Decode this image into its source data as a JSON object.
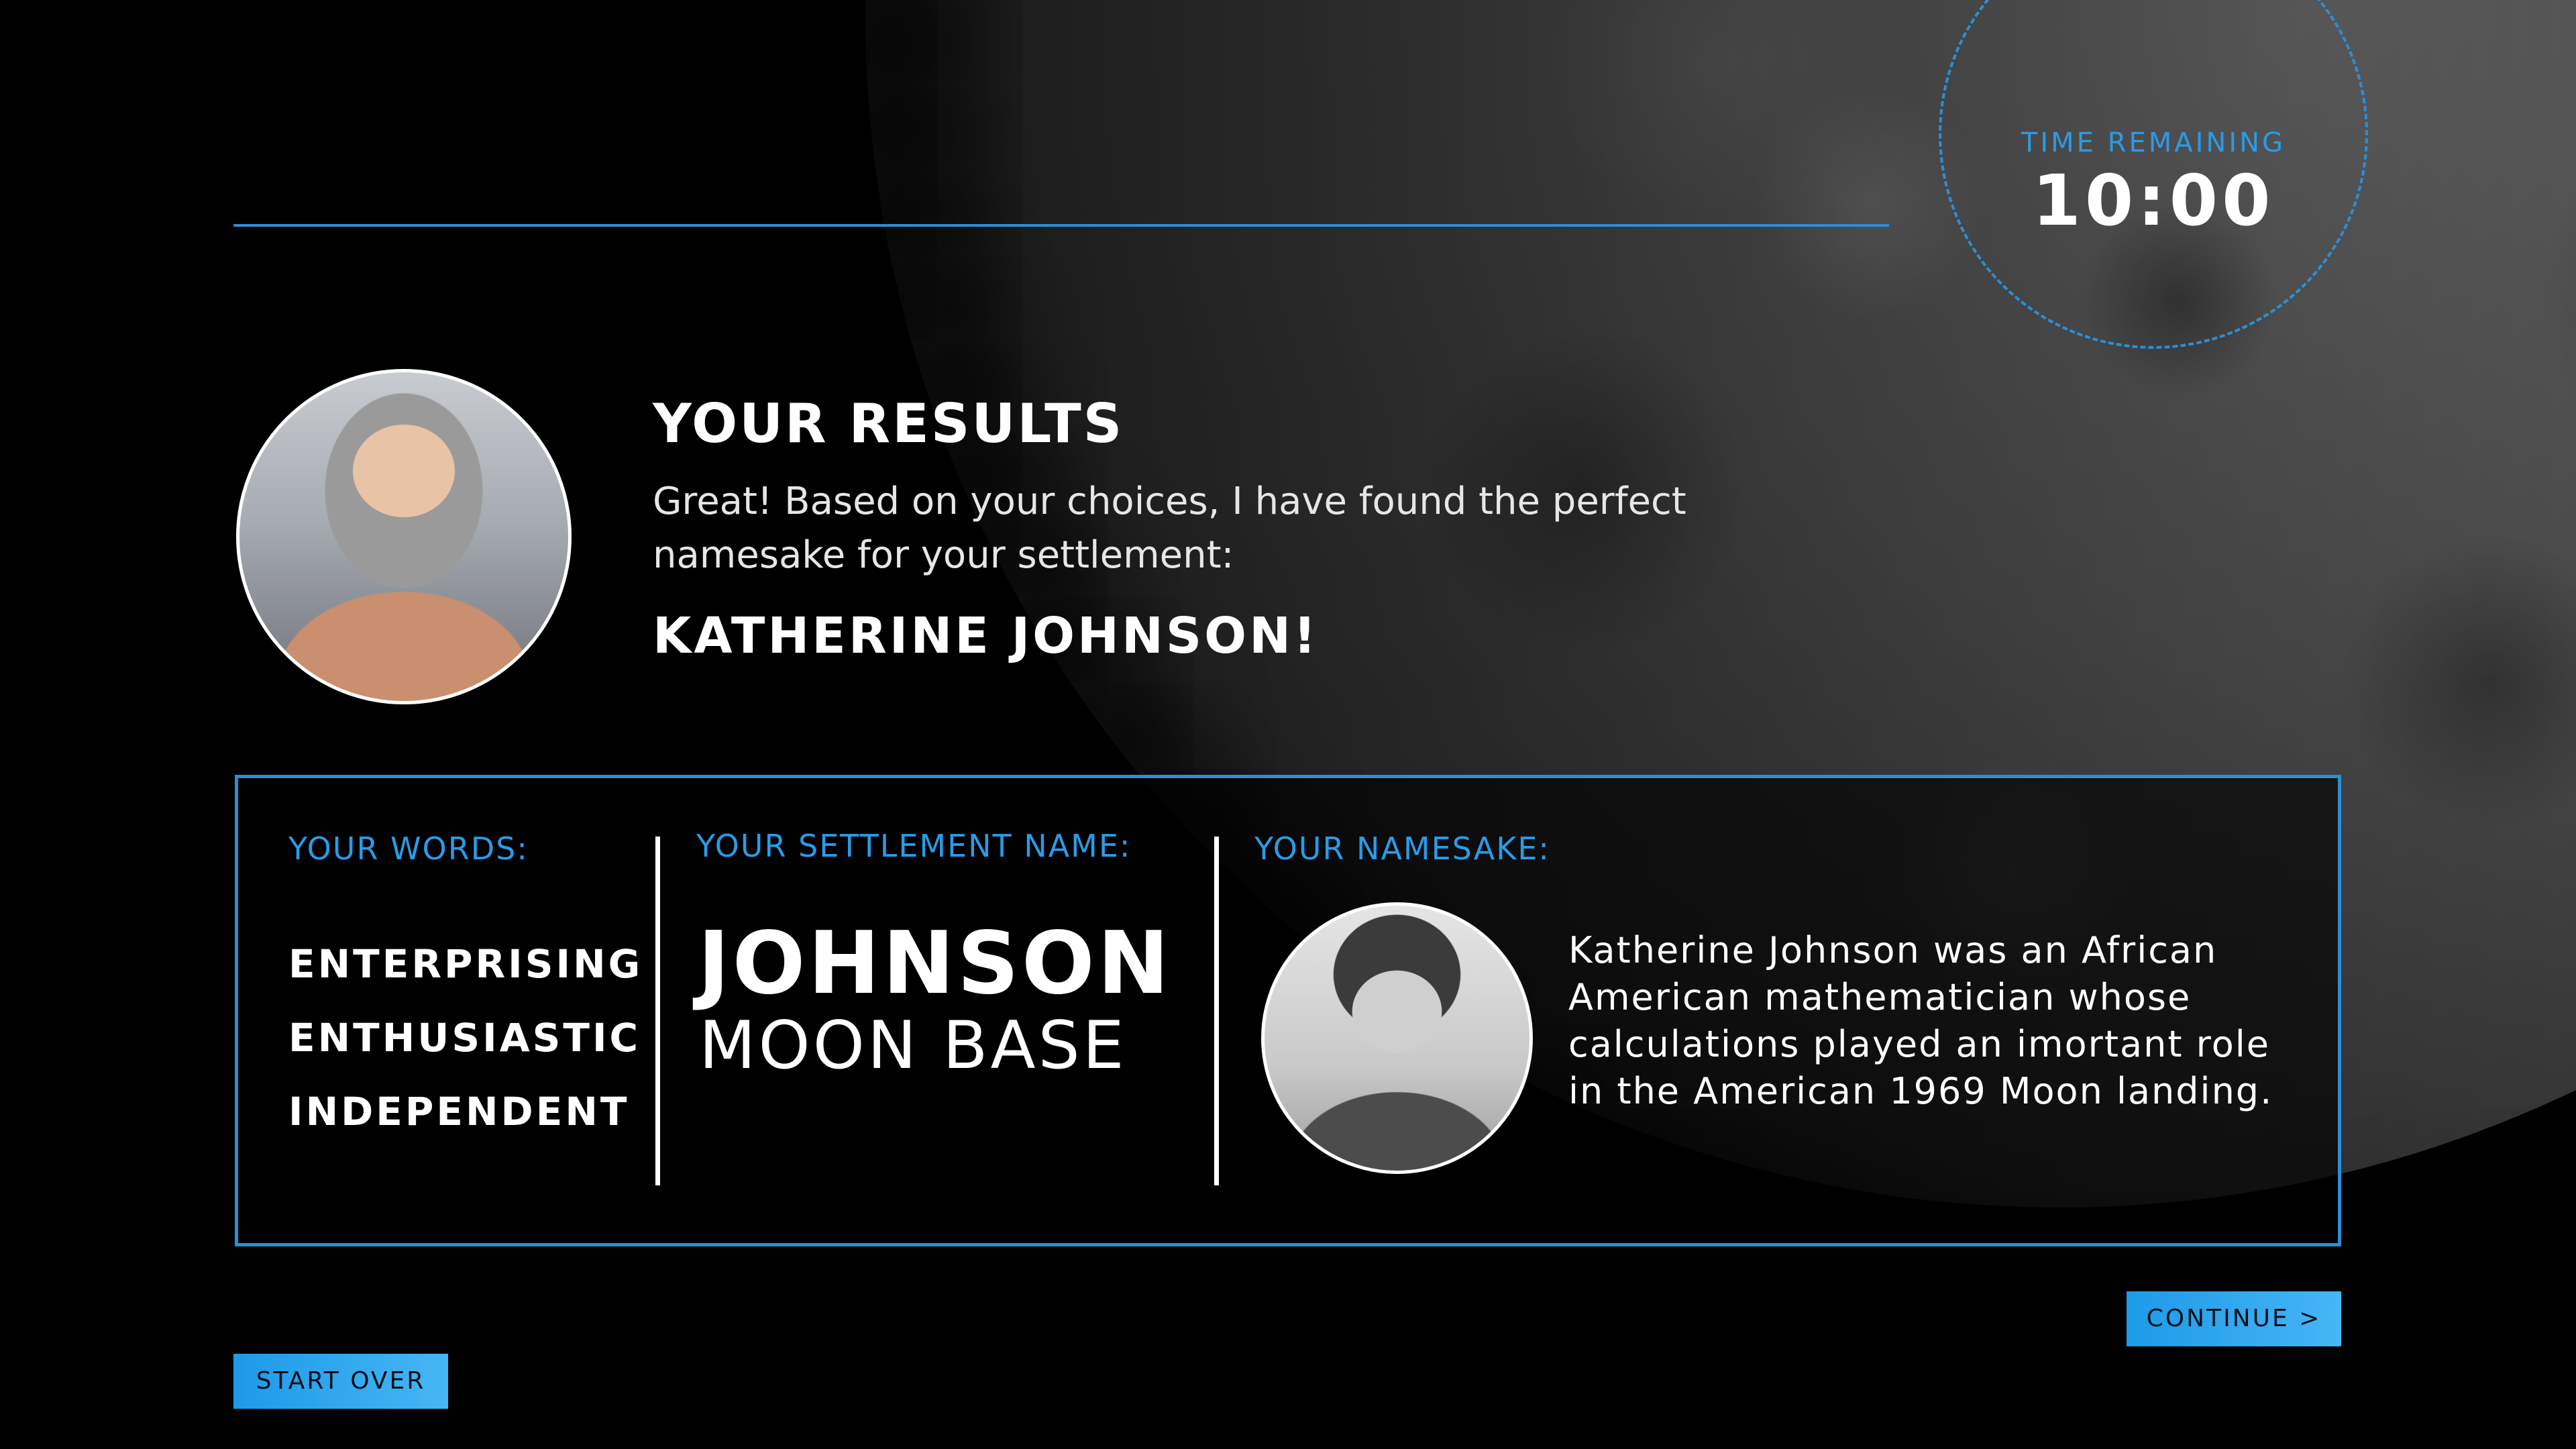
{
  "timer": {
    "label": "TIME REMAINING",
    "value": "10:00"
  },
  "results": {
    "title": "YOUR RESULTS",
    "body": "Great! Based on your choices, I have found the perfect namesake for your settlement:",
    "namesake_name": "KATHERINE JOHNSON!"
  },
  "panel": {
    "words_label": "YOUR WORDS:",
    "words": [
      "ENTERPRISING",
      "ENTHUSIASTIC",
      "INDEPENDENT"
    ],
    "settlement_label": "YOUR SETTLEMENT NAME:",
    "settlement_main": "JOHNSON",
    "settlement_sub": "MOON BASE",
    "namesake_label": "YOUR NAMESAKE:",
    "namesake_bio": "Katherine Johnson was an African American mathematician whose calculations played an imortant role in the American 1969 Moon landing."
  },
  "buttons": {
    "continue": "CONTINUE >",
    "start_over": "START OVER"
  },
  "colors": {
    "accent": "#2a8fd8",
    "label": "#2a9be8",
    "background": "#000000",
    "button_gradient_start": "#1d9ae8",
    "button_gradient_end": "#46b6f5"
  }
}
